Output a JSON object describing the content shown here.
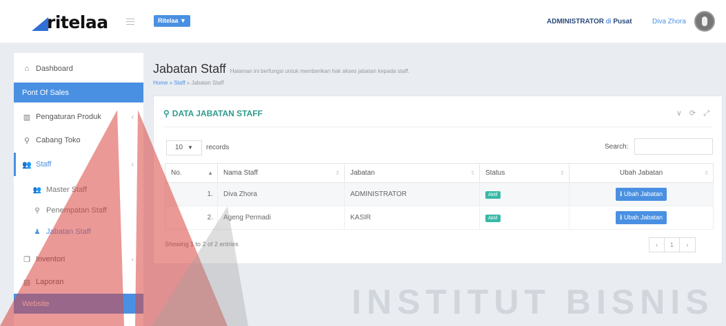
{
  "header": {
    "logo_text": "ritelaa",
    "store_button": "Ritelaa ▼",
    "role": "ADMINISTRATOR",
    "location_prefix": "di",
    "location": "Pusat",
    "user_name": "Diva Zhora"
  },
  "sidebar": {
    "dashboard": "Dashboard",
    "pos_header": "Pont Of Sales",
    "produk": "Pengaturan Produk",
    "cabang": "Cabang Toko",
    "staff": "Staff",
    "staff_sub": [
      {
        "label": "Master Staff"
      },
      {
        "label": "Penempatan Staff"
      },
      {
        "label": "Jabatan Staff"
      }
    ],
    "inventori": "Inventori",
    "laporan": "Laporan",
    "website_header": "Website"
  },
  "page": {
    "title": "Jabatan Staff",
    "subtitle": "Halaman ini berfungsi untuk memberikan hak akses jabatan kepada staff.",
    "breadcrumb_home": "Home",
    "breadcrumb_mid": "» Staff",
    "breadcrumb_current": "» Jabatan Staff"
  },
  "panel": {
    "title": "DATA JABATAN STAFF",
    "tools": "∨ ⟳ ⤢",
    "length_value": "10",
    "length_label": "records",
    "search_label": "Search:",
    "columns": {
      "no": "No.",
      "nama": "Nama Staff",
      "jabatan": "Jabatan",
      "status": "Status",
      "ubah": "Ubah Jabatan"
    },
    "rows": [
      {
        "no": "1.",
        "nama": "Diva Zhora",
        "jabatan": "ADMINISTRATOR",
        "status": "Aktif",
        "action": "ℹ Ubah Jabatan"
      },
      {
        "no": "2.",
        "nama": "Ageng Permadi",
        "jabatan": "KASIR",
        "status": "Aktif",
        "action": "ℹ Ubah Jabatan"
      }
    ],
    "showing": "Showing 1 to 2 of 2 entries",
    "pager_prev": "‹",
    "pager_current": "1",
    "pager_next": "›"
  },
  "watermark": {
    "text": "INSTITUT BISNIS"
  },
  "colors": {
    "accent": "#4a90e2",
    "teal": "#2f9a8c",
    "badge": "#37b9a5",
    "watermark_red": "#d9463f"
  }
}
